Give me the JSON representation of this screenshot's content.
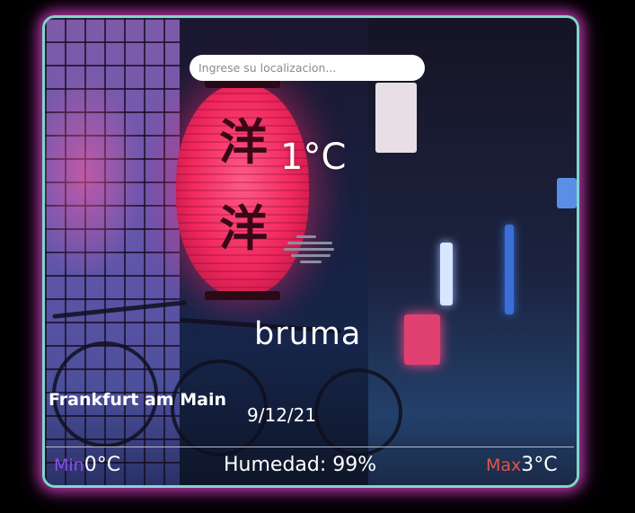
{
  "search": {
    "placeholder": "Ingrese su localizacion..."
  },
  "weather": {
    "temperature": "1°C",
    "condition_icon": "mist-icon",
    "condition": "bruma",
    "city": "Frankfurt am Main",
    "date": "9/12/21",
    "min_label": "Min",
    "min_value": "0°C",
    "humidity": "Humedad: 99%",
    "max_label": "Max",
    "max_value": "3°C"
  },
  "lantern": {
    "glyph": "洋"
  },
  "colors": {
    "card_border": "#7fd6cb",
    "card_glow": "#dc46c8",
    "min_accent": "#8a4ef0",
    "max_accent": "#e2554c",
    "text": "#ffffff"
  }
}
